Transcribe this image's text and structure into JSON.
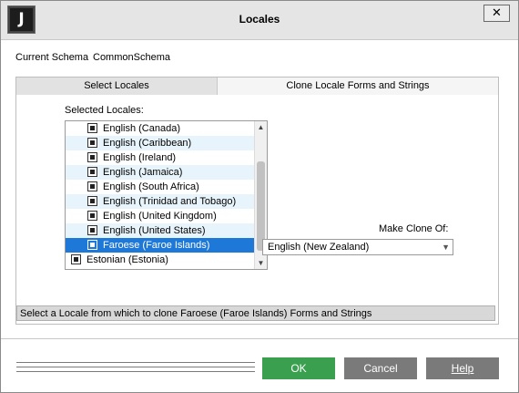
{
  "window": {
    "title": "Locales",
    "app_icon_letter": "J",
    "close_glyph": "✕"
  },
  "schema": {
    "label": "Current Schema",
    "value": "CommonSchema"
  },
  "tabs": [
    {
      "label": "Select Locales",
      "active": false
    },
    {
      "label": "Clone Locale Forms and Strings",
      "active": true
    }
  ],
  "selected_locales": {
    "label": "Selected Locales:",
    "items": [
      {
        "label": "English (Canada)",
        "checked": true,
        "selected": false
      },
      {
        "label": "English (Caribbean)",
        "checked": true,
        "selected": false
      },
      {
        "label": "English (Ireland)",
        "checked": true,
        "selected": false
      },
      {
        "label": "English (Jamaica)",
        "checked": true,
        "selected": false
      },
      {
        "label": "English (South Africa)",
        "checked": true,
        "selected": false
      },
      {
        "label": "English (Trinidad and Tobago)",
        "checked": true,
        "selected": false
      },
      {
        "label": "English (United Kingdom)",
        "checked": true,
        "selected": false
      },
      {
        "label": "English (United States)",
        "checked": true,
        "selected": false
      },
      {
        "label": "Faroese (Faroe Islands)",
        "checked": true,
        "selected": true
      },
      {
        "label": "Estonian (Estonia)",
        "checked": true,
        "selected": false
      }
    ]
  },
  "clone": {
    "label": "Make Clone Of:",
    "value": "English (New Zealand)"
  },
  "status": {
    "text": "Select a Locale from which to clone Faroese (Faroe Islands) Forms and Strings"
  },
  "buttons": {
    "ok": "OK",
    "cancel": "Cancel",
    "help": "Help"
  },
  "colors": {
    "ok_button": "#3aa04f",
    "secondary_button": "#7a7a7a",
    "selection": "#1e78d7",
    "alt_row": "#e8f4fb"
  }
}
